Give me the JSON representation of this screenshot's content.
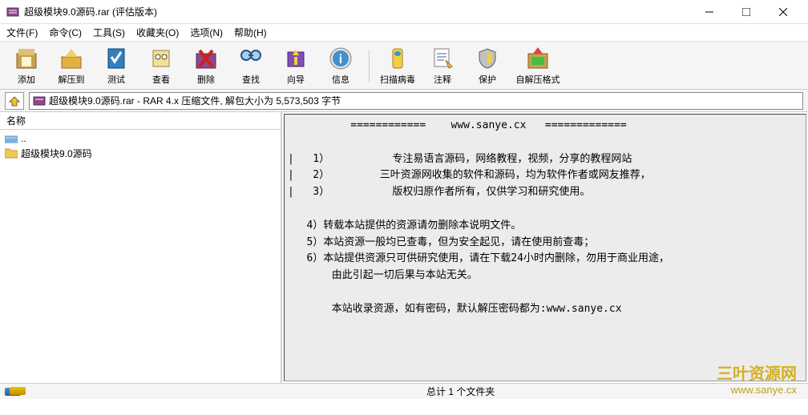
{
  "window": {
    "title": "超级模块9.0源码.rar (评估版本)"
  },
  "menu": {
    "file": "文件(F)",
    "cmd": "命令(C)",
    "tools": "工具(S)",
    "fav": "收藏夹(O)",
    "opt": "选项(N)",
    "help": "帮助(H)"
  },
  "toolbar": {
    "add": "添加",
    "extract": "解压到",
    "test": "测试",
    "view": "查看",
    "delete": "删除",
    "find": "查找",
    "wizard": "向导",
    "info": "信息",
    "scan": "扫描病毒",
    "comment": "注释",
    "protect": "保护",
    "sfx": "自解压格式"
  },
  "address": "超级模块9.0源码.rar - RAR 4.x 压缩文件, 解包大小为 5,573,503 字节",
  "columns": {
    "name": "名称"
  },
  "tree": {
    "parent": "..",
    "folder": "超级模块9.0源码"
  },
  "preview": "          ============    www.sanye.cx   =============\n\n|   1）          专注易语言源码，网络教程，视频，分享的教程网站\n|   2）        三叶资源网收集的软件和源码，均为软件作者或网友推荐，\n|   3）          版权归原作者所有，仅供学习和研究使用。\n\n   4）转载本站提供的资源请勿删除本说明文件。\n   5）本站资源一般均已查毒，但为安全起见，请在使用前查毒；\n   6）本站提供资源只可供研究使用，请在下载24小时内删除，勿用于商业用途，\n       由此引起一切后果与本站无关。\n\n       本站收录资源，如有密码，默认解压密码都为:www.sanye.cx",
  "status": {
    "summary": "总计 1 个文件夹"
  },
  "watermark": {
    "l1": "三叶资源网",
    "l2": "www.sanye.cx"
  }
}
